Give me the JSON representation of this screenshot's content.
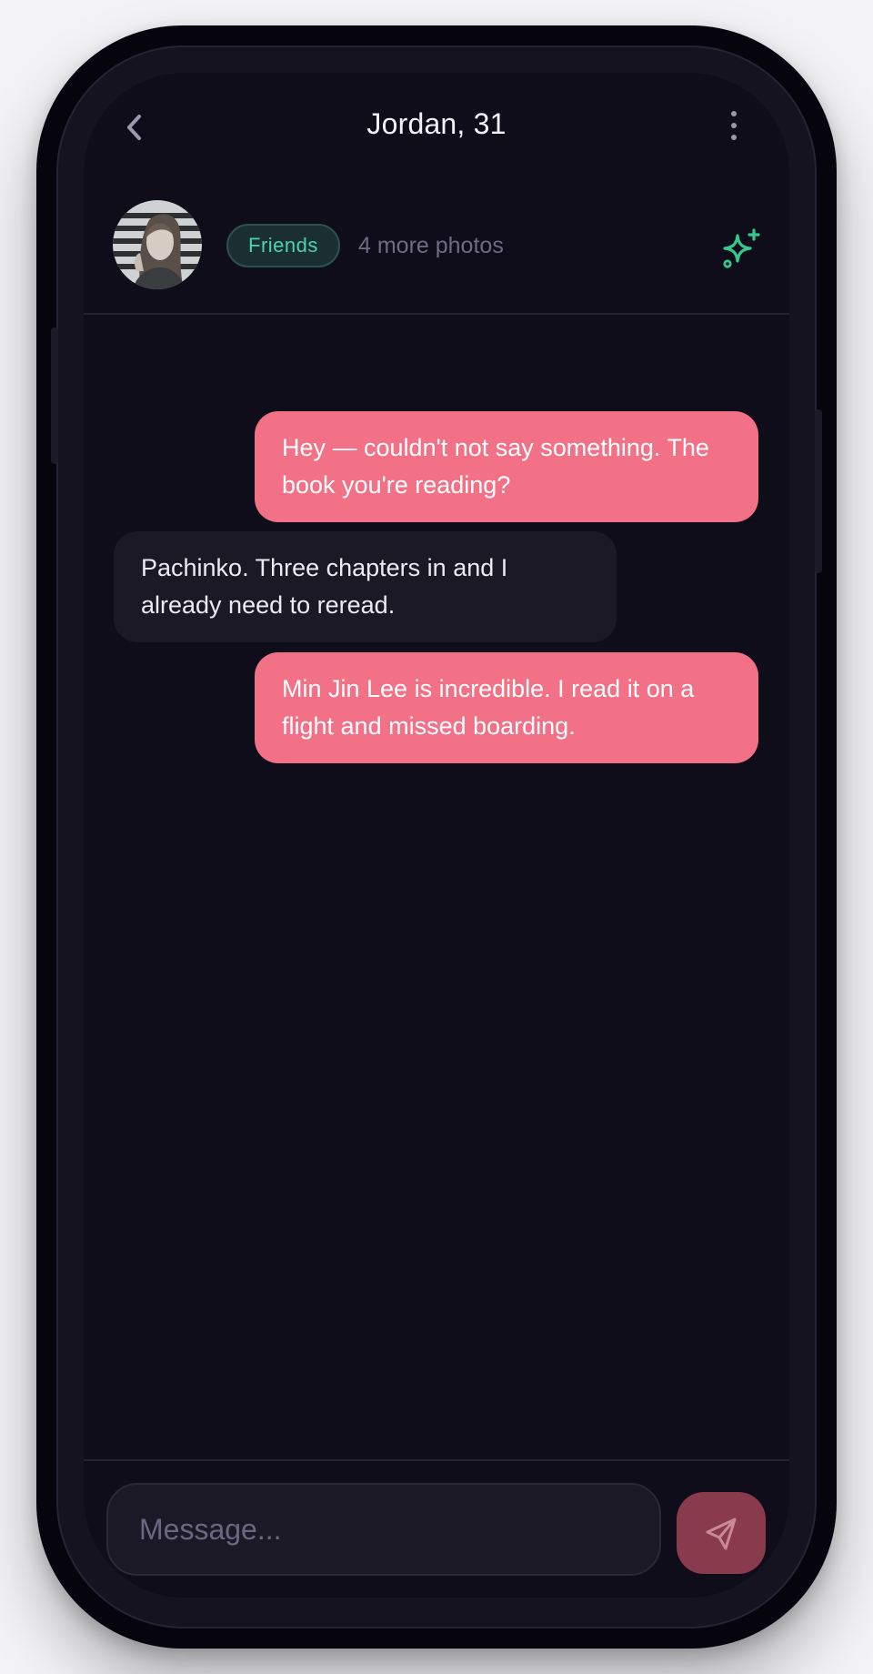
{
  "app": {
    "title": "Jordan, 31",
    "accent": "#f27186",
    "badge_color": "#4fd1b3"
  },
  "header": {
    "back_icon": "chevron-left-icon",
    "menu_icon": "more-vertical-icon"
  },
  "profile": {
    "avatar": "profile-photo",
    "badge_label": "Friends",
    "photos_label": "4 more photos",
    "spark_icon": "sparkle-icon"
  },
  "messages": [
    {
      "from": "me",
      "text": "Hey — couldn't not say something. The book you're reading?"
    },
    {
      "from": "them",
      "text": "Pachinko. Three chapters in and I already need to reread."
    },
    {
      "from": "me",
      "text": "Min Jin Lee is incredible. I read it on a flight and missed boarding."
    }
  ],
  "composer": {
    "placeholder": "Message...",
    "send_icon": "send-icon"
  }
}
